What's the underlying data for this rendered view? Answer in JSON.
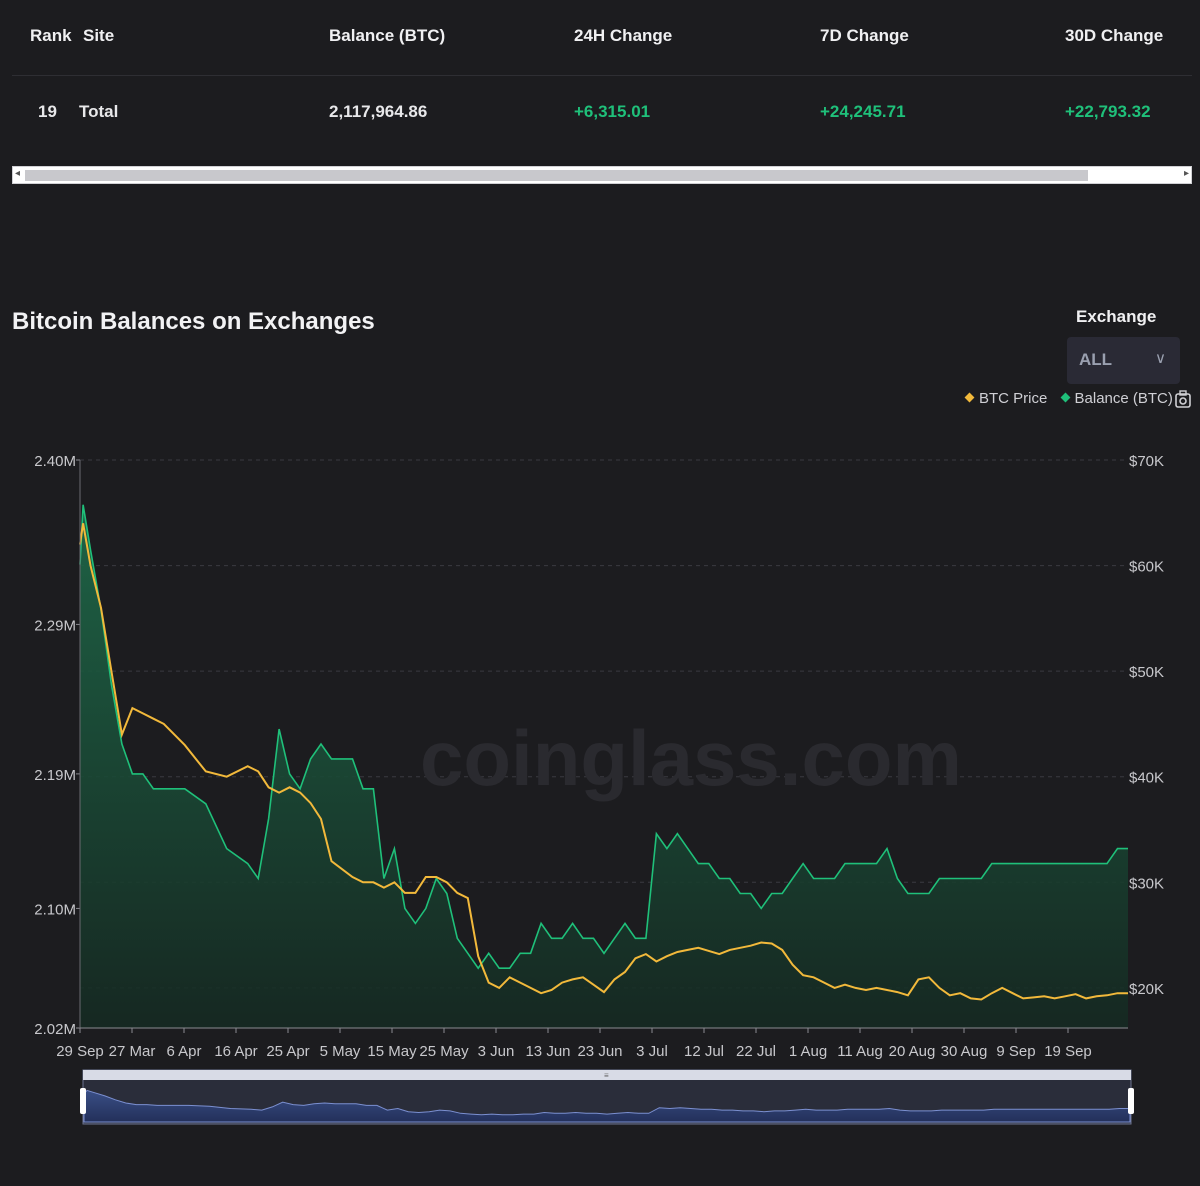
{
  "table": {
    "headers": {
      "rank": "Rank",
      "site": "Site",
      "balance": "Balance (BTC)",
      "change_24h": "24H Change",
      "change_7d": "7D Change",
      "change_30d": "30D Change"
    },
    "rows": [
      {
        "rank": "19",
        "site": "Total",
        "balance": "2,117,964.86",
        "change_24h": "+6,315.01",
        "change_7d": "+24,245.71",
        "change_30d": "+22,793.32"
      }
    ]
  },
  "chart_section": {
    "title": "Bitcoin Balances on Exchanges",
    "exchange_label": "Exchange",
    "exchange_value": "ALL",
    "watermark": "coinglass.com"
  },
  "colors": {
    "price": "#f2b93b",
    "balance": "#1fc07a",
    "positive": "#1fc07a",
    "background": "#1c1c1f"
  },
  "chart_data": {
    "type": "line",
    "title": "Bitcoin Balances on Exchanges",
    "legend": [
      "BTC Price",
      "Balance (BTC)"
    ],
    "legend_position": "top-right",
    "grid": true,
    "x_tick_labels": [
      "29 Sep",
      "27 Mar",
      "6 Apr",
      "16 Apr",
      "25 Apr",
      "5 May",
      "15 May",
      "25 May",
      "3 Jun",
      "13 Jun",
      "23 Jun",
      "3 Jul",
      "12 Jul",
      "22 Jul",
      "1 Aug",
      "11 Aug",
      "20 Aug",
      "30 Aug",
      "9 Sep",
      "19 Sep"
    ],
    "y_left_ticks": [
      "2.40M",
      "2.29M",
      "2.19M",
      "2.10M",
      "2.02M"
    ],
    "y_left_values": [
      2400000,
      2290000,
      2190000,
      2100000,
      2020000
    ],
    "y_right_ticks": [
      "$70K",
      "$60K",
      "$50K",
      "$40K",
      "$30K",
      "$20K"
    ],
    "y_right_values": [
      70000,
      60000,
      50000,
      40000,
      30000,
      20000
    ],
    "x": [
      0,
      0.3,
      1,
      2,
      3,
      4,
      5,
      6,
      7,
      8,
      10,
      12,
      14,
      16,
      17,
      18,
      19,
      20,
      21,
      22,
      23,
      24,
      26,
      27,
      28,
      29,
      30,
      31,
      32,
      33,
      34,
      35,
      36,
      37,
      38,
      39,
      40,
      41,
      42,
      43,
      44,
      45,
      46,
      47,
      48,
      49,
      50,
      51,
      52,
      53,
      54,
      55,
      56,
      57,
      58,
      59,
      60,
      61,
      62,
      63,
      64,
      65,
      66,
      67,
      68,
      69,
      70,
      71,
      72,
      73,
      74,
      75,
      76,
      77,
      78,
      79,
      80,
      81,
      82,
      83,
      84,
      85,
      86,
      87,
      88,
      89,
      90,
      91,
      92,
      93,
      94,
      95,
      96,
      97,
      98,
      99,
      100
    ],
    "series": [
      {
        "name": "Balance (BTC)",
        "axis": "left",
        "values": [
          2330000,
          2370000,
          2340000,
          2300000,
          2250000,
          2210000,
          2190000,
          2190000,
          2180000,
          2180000,
          2180000,
          2170000,
          2140000,
          2130000,
          2120000,
          2160000,
          2220000,
          2190000,
          2180000,
          2200000,
          2210000,
          2200000,
          2200000,
          2180000,
          2180000,
          2120000,
          2140000,
          2100000,
          2090000,
          2100000,
          2120000,
          2110000,
          2080000,
          2070000,
          2060000,
          2070000,
          2060000,
          2060000,
          2070000,
          2070000,
          2090000,
          2080000,
          2080000,
          2090000,
          2080000,
          2080000,
          2070000,
          2080000,
          2090000,
          2080000,
          2080000,
          2150000,
          2140000,
          2150000,
          2140000,
          2130000,
          2130000,
          2120000,
          2120000,
          2110000,
          2110000,
          2100000,
          2110000,
          2110000,
          2120000,
          2130000,
          2120000,
          2120000,
          2120000,
          2130000,
          2130000,
          2130000,
          2130000,
          2140000,
          2120000,
          2110000,
          2110000,
          2110000,
          2120000,
          2120000,
          2120000,
          2120000,
          2120000,
          2130000,
          2130000,
          2130000,
          2130000,
          2130000,
          2130000,
          2130000,
          2130000,
          2130000,
          2130000,
          2130000,
          2130000,
          2140000,
          2140000
        ]
      },
      {
        "name": "BTC Price",
        "axis": "right",
        "values": [
          62000,
          64000,
          60000,
          56000,
          50000,
          44000,
          46500,
          46000,
          45500,
          45000,
          43000,
          40500,
          40000,
          41000,
          40500,
          39000,
          38500,
          39000,
          38500,
          37500,
          36000,
          32000,
          30500,
          30000,
          30000,
          29500,
          30000,
          29000,
          29000,
          30500,
          30500,
          30000,
          29000,
          28500,
          23000,
          20500,
          20000,
          21000,
          20500,
          20000,
          19500,
          19800,
          20500,
          20800,
          21000,
          20300,
          19600,
          20800,
          21500,
          22800,
          23200,
          22500,
          23000,
          23400,
          23600,
          23800,
          23500,
          23200,
          23600,
          23800,
          24000,
          24300,
          24200,
          23600,
          22200,
          21200,
          21000,
          20500,
          20000,
          20300,
          20000,
          19800,
          20000,
          19800,
          19600,
          19300,
          20800,
          21000,
          20000,
          19300,
          19500,
          19000,
          18900,
          19500,
          20000,
          19500,
          19000,
          19100,
          19200,
          19000,
          19200,
          19400,
          19000,
          19200,
          19300,
          19500,
          19500
        ]
      }
    ]
  }
}
